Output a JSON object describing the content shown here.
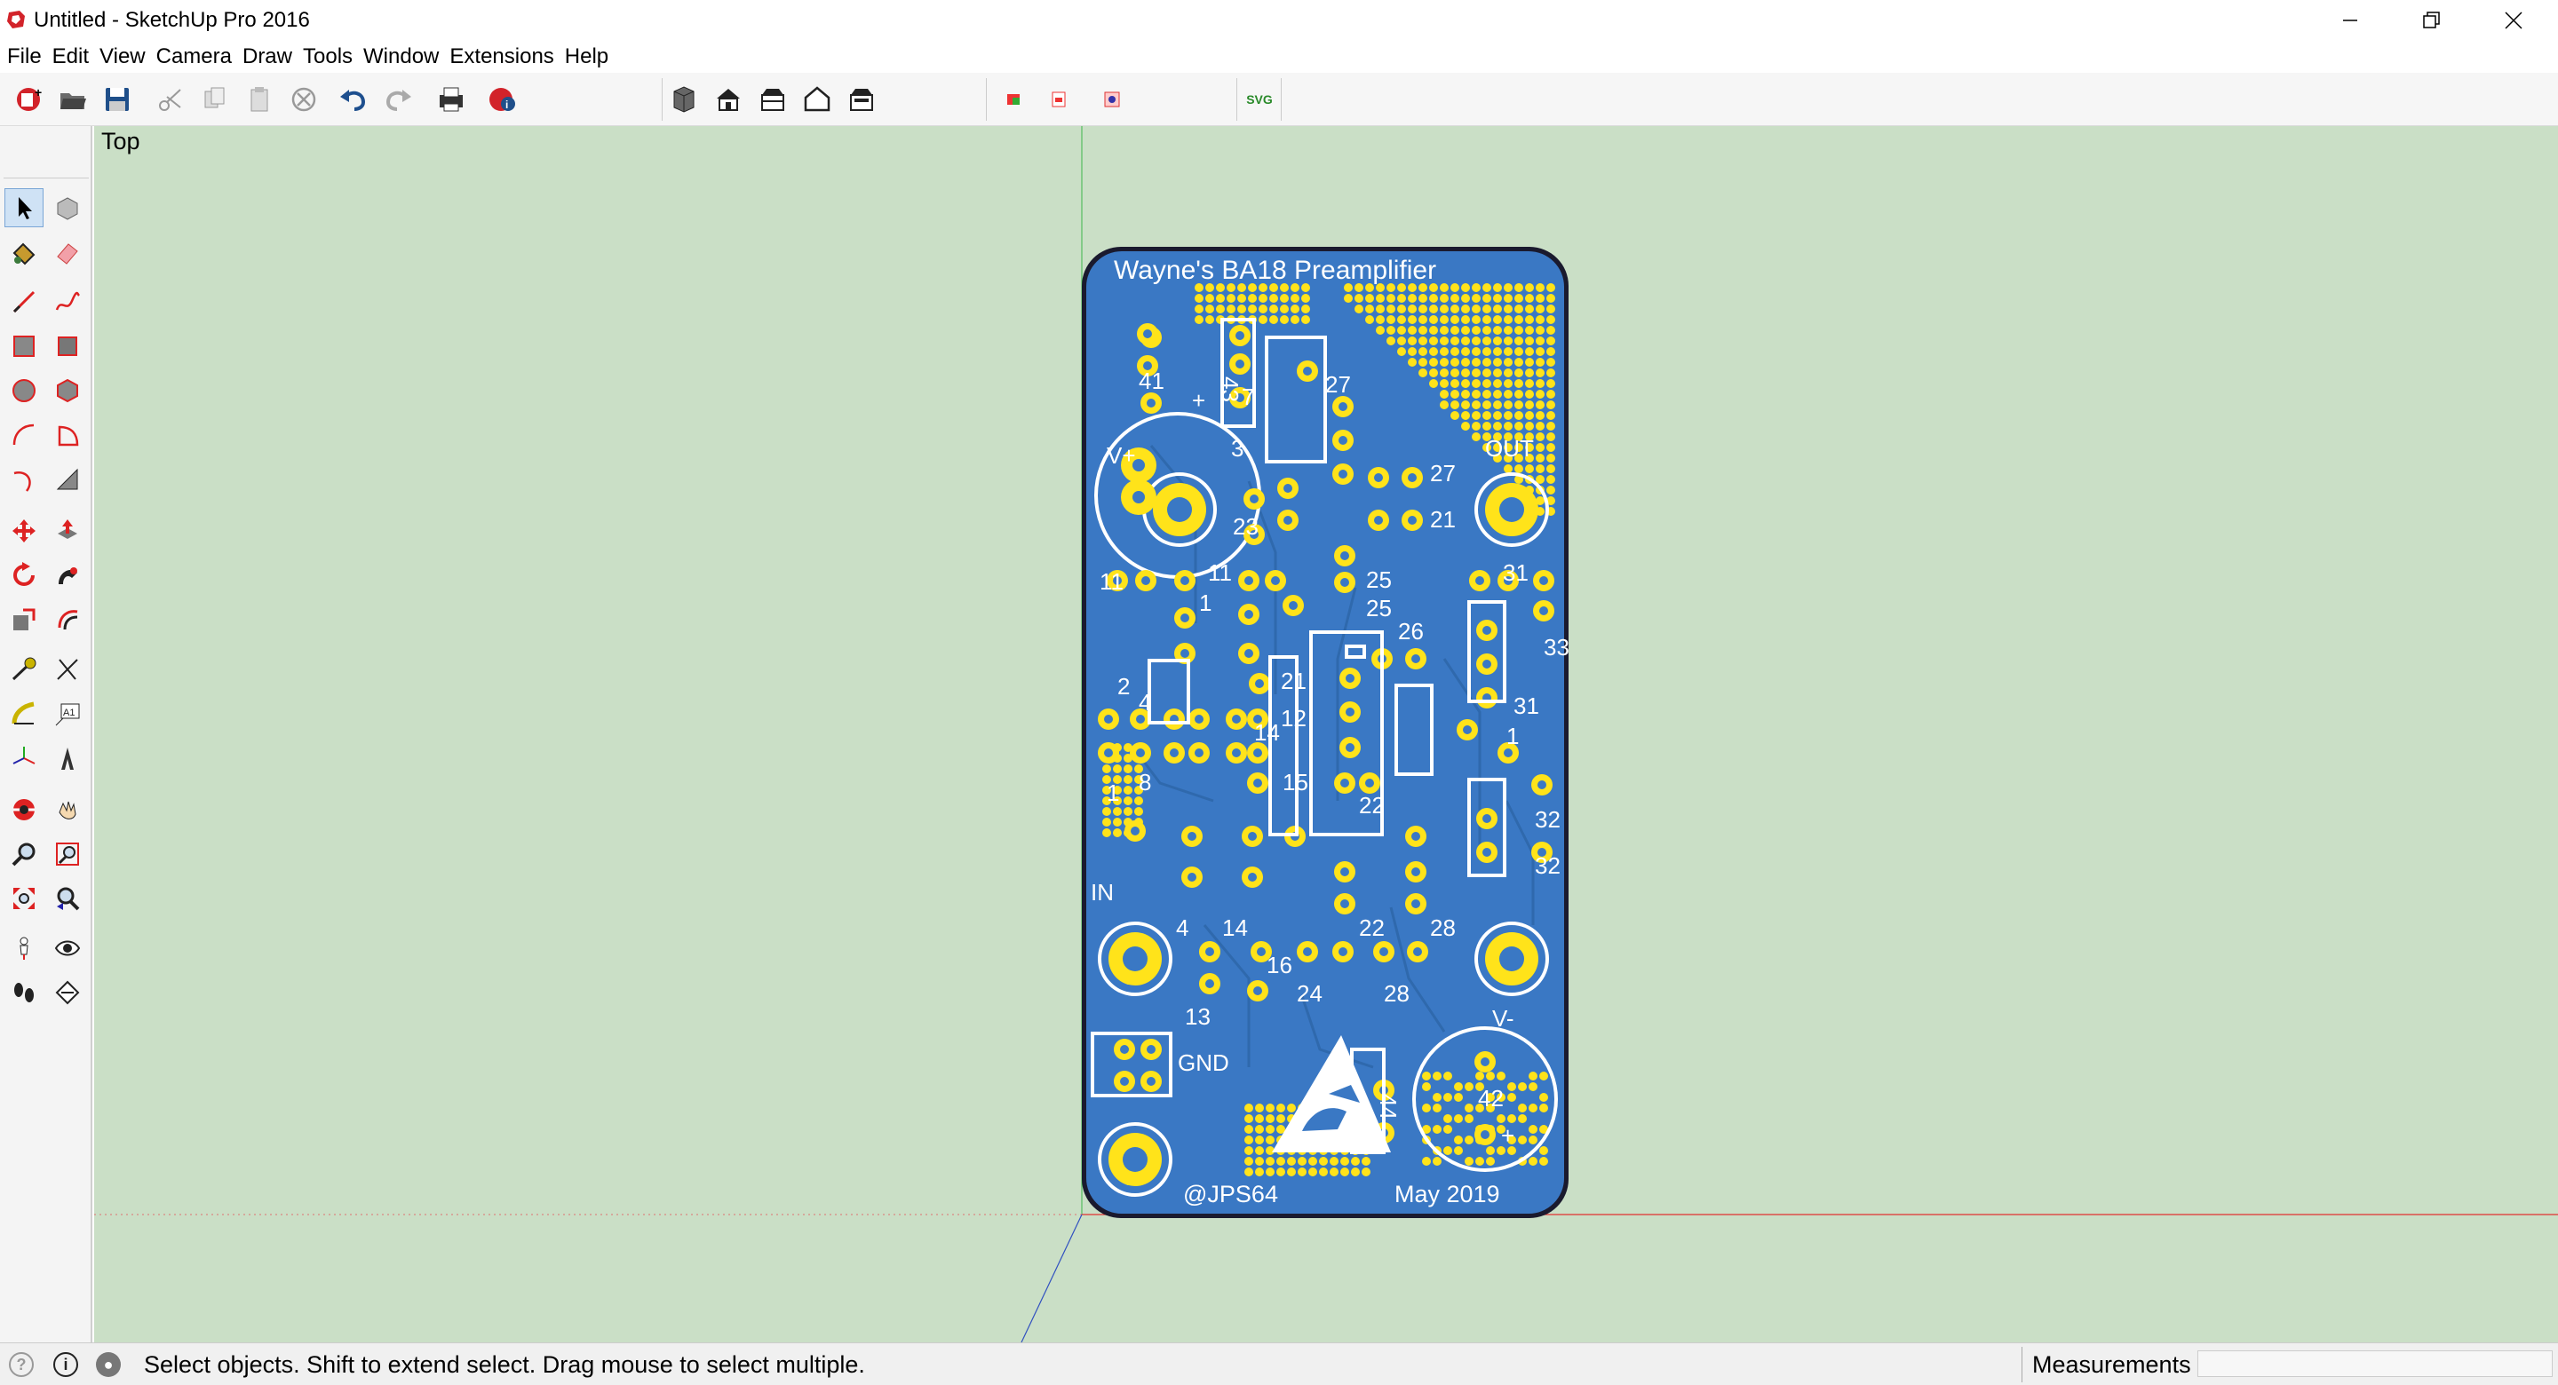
{
  "window": {
    "title": "Untitled - SketchUp Pro 2016"
  },
  "menu": [
    "File",
    "Edit",
    "View",
    "Camera",
    "Draw",
    "Tools",
    "Window",
    "Extensions",
    "Help"
  ],
  "toolbar": {
    "tools": [
      "new-icon",
      "open-icon",
      "save-icon",
      "cut-icon",
      "copy-icon",
      "paste-icon",
      "erase-icon",
      "undo-icon",
      "redo-icon",
      "print-icon",
      "model-info-icon",
      "iso-view-icon",
      "top-view-icon",
      "front-view-icon",
      "right-view-icon",
      "back-view-icon",
      "extension-icon-1",
      "extension-icon-2",
      "extension-icon-3"
    ],
    "svg_label": "SVG"
  },
  "left_tools": [
    "select-icon",
    "make-component-icon",
    "paint-bucket-icon",
    "eraser-icon",
    "line-icon",
    "freehand-icon",
    "rectangle-icon",
    "rotated-rectangle-icon",
    "circle-icon",
    "polygon-icon",
    "arc-icon",
    "pie-icon",
    "two-point-arc-icon",
    "three-point-arc-icon",
    "move-icon",
    "push-pull-icon",
    "rotate-icon",
    "follow-me-icon",
    "scale-icon",
    "offset-icon",
    "tape-measure-icon",
    "dimension-icon",
    "protractor-icon",
    "text-icon",
    "axes-icon",
    "3d-text-icon",
    "orbit-icon",
    "pan-icon",
    "zoom-icon",
    "zoom-window-icon",
    "zoom-extents-icon",
    "previous-view-icon",
    "position-camera-icon",
    "look-around-icon",
    "walk-icon",
    "section-plane-icon"
  ],
  "viewport": {
    "scene_label": "Top",
    "background": "#cadfc6"
  },
  "pcb": {
    "title": "Wayne's BA18 Preamplifier",
    "author": "@JPS64",
    "date": "May 2019",
    "labels": [
      "41",
      "+",
      "V+",
      "OUT",
      "27",
      "27",
      "21",
      "23",
      "25",
      "25",
      "11",
      "11",
      "1",
      "31",
      "33",
      "26",
      "21",
      "12",
      "2",
      "4",
      "31",
      "14",
      "1",
      "22",
      "1",
      "8",
      "15",
      "32",
      "32",
      "IN",
      "4",
      "14",
      "22",
      "28",
      "16",
      "24",
      "28",
      "13",
      "GND",
      "V-",
      "44",
      "42",
      "+",
      "3",
      "7",
      "43"
    ],
    "colors": {
      "board": "#3a78c4",
      "board_edge": "#1a1a2e",
      "copper": "#ffe31a",
      "silk": "#ffffff",
      "trace": "#2f69ad"
    }
  },
  "status": {
    "hint": "Select objects. Shift to extend select. Drag mouse to select multiple.",
    "measurements_label": "Measurements",
    "measurements_value": ""
  }
}
